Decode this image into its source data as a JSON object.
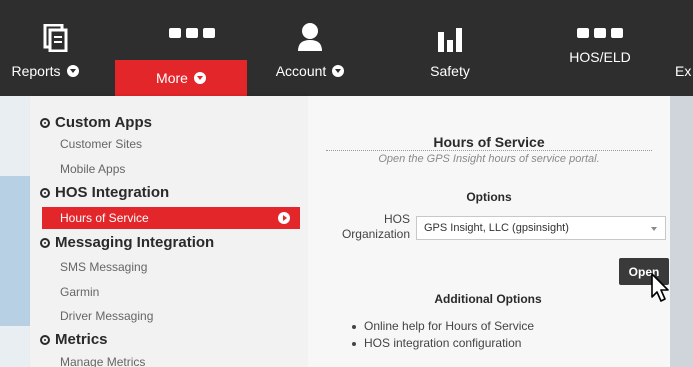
{
  "nav": {
    "items": [
      {
        "label": "Reports",
        "icon": "reports-icon",
        "has_caret": true
      },
      {
        "label": "More",
        "icon": "more-icon",
        "has_caret": true,
        "active": true
      },
      {
        "label": "Account",
        "icon": "account-icon",
        "has_caret": true
      },
      {
        "label": "Safety",
        "icon": "safety-icon",
        "has_caret": false
      },
      {
        "label": "HOS/ELD",
        "icon": "more-dots-icon",
        "has_caret": false
      },
      {
        "label": "Ex",
        "icon": "",
        "has_caret": false
      }
    ]
  },
  "menu": {
    "sections": [
      {
        "title": "Custom Apps",
        "items": [
          "Customer Sites",
          "Mobile Apps"
        ]
      },
      {
        "title": "HOS Integration",
        "items": [
          "Hours of Service"
        ],
        "active_item": "Hours of Service"
      },
      {
        "title": "Messaging Integration",
        "items": [
          "SMS Messaging",
          "Garmin",
          "Driver Messaging"
        ]
      },
      {
        "title": "Metrics",
        "items": [
          "Manage Metrics"
        ]
      }
    ]
  },
  "panel": {
    "title": "Hours of Service",
    "subtitle": "Open the GPS Insight hours of service portal.",
    "options_heading": "Options",
    "field_label": "HOS Organization",
    "field_label_line1": "HOS",
    "field_label_line2": "Organization",
    "select_value": "GPS Insight, LLC (gpsinsight)",
    "open_button": "Open",
    "additional_heading": "Additional Options",
    "links": [
      "Online help for Hours of Service",
      "HOS integration configuration"
    ]
  },
  "colors": {
    "nav_bg": "#2e2e2e",
    "accent_red": "#e3262a",
    "menu_bg": "#f2f2f2",
    "panel_bg": "#f7f7f7",
    "button_bg": "#3a3a3a"
  }
}
